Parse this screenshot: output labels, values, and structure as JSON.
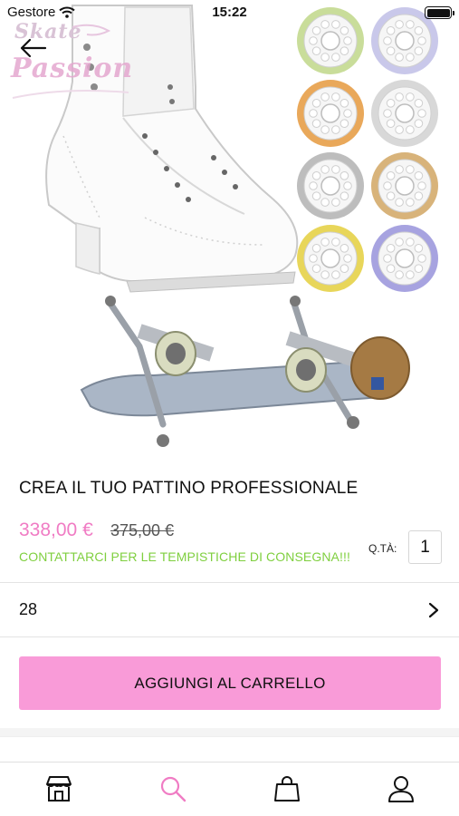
{
  "status_bar": {
    "carrier": "Gestore",
    "time": "15:22",
    "battery_level": 1.0
  },
  "brand": {
    "logo_line1": "Skate",
    "logo_line2": "Passion"
  },
  "product": {
    "title": "CREA IL TUO PATTINO PROFESSIONALE",
    "price": "338,00 €",
    "old_price": "375,00 €",
    "delivery_note": "CONTATTARCI PER LE TEMPISTICHE DI CONSEGNA!!!",
    "quantity_label": "Q.TÀ:",
    "quantity": "1",
    "size": "28"
  },
  "actions": {
    "add_to_cart_label": "AGGIUNGI AL CARRELLO"
  },
  "wheel_colors": [
    "#c9dd9a",
    "#c9c8ea",
    "#e9a85a",
    "#d8d8d8",
    "#bdbdbd",
    "#d8b37a",
    "#e8d65a",
    "#a7a3e0"
  ],
  "colors": {
    "accent_pink": "#f07cc4",
    "button_pink": "#f99bd8",
    "note_green": "#7fcf3f"
  },
  "tab_bar": {
    "items": [
      {
        "icon": "store-icon",
        "active": false
      },
      {
        "icon": "search-icon",
        "active": true
      },
      {
        "icon": "bag-icon",
        "active": false
      },
      {
        "icon": "user-icon",
        "active": false
      }
    ]
  }
}
